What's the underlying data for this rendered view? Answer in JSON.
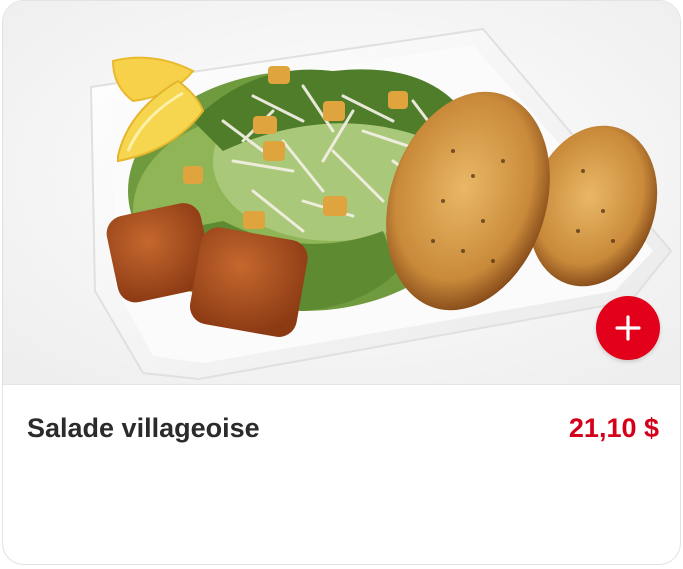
{
  "product": {
    "image_alt": "Salade villageoise",
    "name": "Salade villageoise",
    "price": "21,10 $",
    "add_button_icon": "plus-icon"
  },
  "colors": {
    "accent": "#e3001b",
    "price": "#d4001a",
    "name": "#2b2b2b"
  }
}
